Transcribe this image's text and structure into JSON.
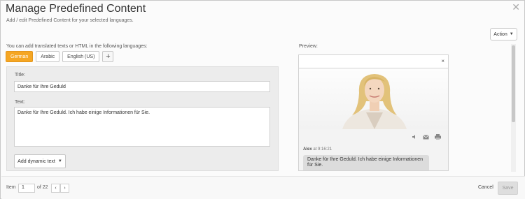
{
  "dialog": {
    "title": "Manage Predefined Content",
    "subtitle": "Add / edit Predefined Content for your selected languages.",
    "close_glyph": "✕",
    "action_label": "Action"
  },
  "languages": {
    "hint": "You can add translated texts or HTML in the following languages:",
    "tabs": [
      {
        "label": "German",
        "active": true
      },
      {
        "label": "Arabic",
        "active": false
      },
      {
        "label": "English (US)",
        "active": false
      }
    ],
    "add_glyph": "+"
  },
  "form": {
    "title_label": "Title:",
    "title_value": "Danke für Ihre Geduld",
    "text_label": "Text:",
    "text_value": "Danke für Ihre Geduld. Ich habe einige Informationen für Sie.",
    "dynamic_text_label": "Add dynamic text"
  },
  "preview": {
    "label": "Preview:",
    "close_glyph": "×",
    "agent_name": "Alex",
    "time_text": " at 9:16:21",
    "message": "Danke für Ihre Geduld. Ich habe einige Informationen für Sie.",
    "tool_icons": [
      "speaker-icon",
      "email-icon",
      "print-icon"
    ]
  },
  "footer": {
    "item_label": "Item",
    "item_value": "1",
    "of_label": "of 22",
    "prev_glyph": "‹",
    "next_glyph": "›",
    "cancel_label": "Cancel",
    "save_label": "Save"
  },
  "colors": {
    "accent": "#f5a623",
    "panel": "#ececec",
    "disabled": "#dedede"
  }
}
